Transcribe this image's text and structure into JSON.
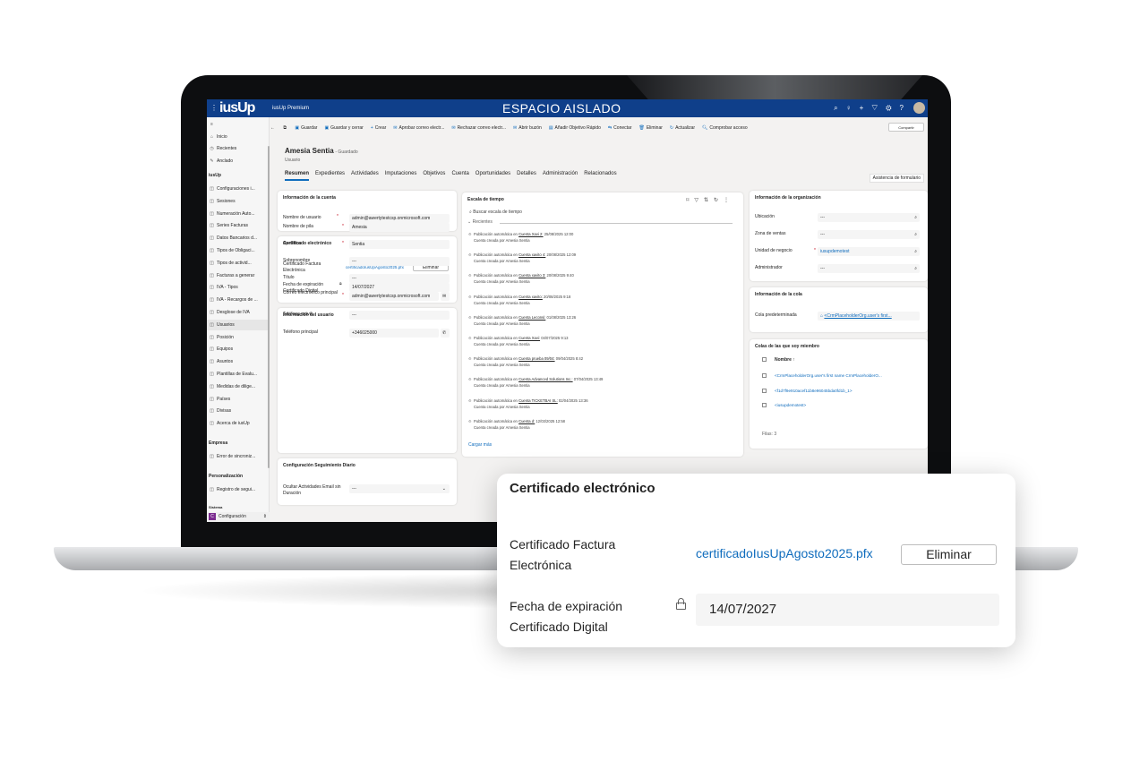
{
  "topbar": {
    "logo": "iusUp",
    "app_title": "iusUp Premium",
    "environment": "ESPACIO AISLADO",
    "icons": [
      "search-icon",
      "lightbulb-icon",
      "plus-icon",
      "filter-icon",
      "gear-icon",
      "help-icon"
    ]
  },
  "sidebar": {
    "items": [
      {
        "label": "Inicio",
        "icon": "home-icon"
      },
      {
        "label": "Recientes",
        "icon": "clock-icon"
      },
      {
        "label": "Anclado",
        "icon": "pin-icon"
      }
    ],
    "section_iusup": "iusUp",
    "iusup_items": [
      "Configuraciones i...",
      "Sesiones",
      "Numeración Auto...",
      "Series Facturas",
      "Datos Bancarios d...",
      "Tipos de Obligaci...",
      "Tipos de activid...",
      "Facturas a generar",
      "IVA - Tipos",
      "IVA - Recargos de ...",
      "Desglose de IVA",
      "Usuarios",
      "Posición",
      "Equipos",
      "Asuntos",
      "Plantillas de Evalu...",
      "Medidas de dilige...",
      "Países",
      "Divisas",
      "Acerca de iusUp"
    ],
    "section_empresa": "Empresa",
    "empresa_items": [
      "Error de sincroniz..."
    ],
    "section_personalizacion": "Personalización",
    "personalizacion_items": [
      "Registro de segui..."
    ],
    "section_sistema": "Sistema",
    "area": {
      "letter": "C",
      "label": "Configuración"
    }
  },
  "commands": [
    "Guardar",
    "Guardar y cerrar",
    "Crear",
    "Aprobar correo electr...",
    "Rechazar correo electr...",
    "Abrir buzón",
    "Añadir Objetivo Rápido",
    "Conectar",
    "Eliminar",
    "Actualizar",
    "Comprobar acceso"
  ],
  "share_label": "Compartir",
  "record": {
    "name": "Amesia Sentia",
    "state": "- Guardado",
    "type": "Usuario"
  },
  "tabs": [
    "Resumen",
    "Expedientes",
    "Actividades",
    "Imputaciones",
    "Objetivos",
    "Cuenta",
    "Oportunidades",
    "Detalles",
    "Administración",
    "Relacionados"
  ],
  "assist_label": "Asistencia de formulario",
  "account": {
    "title": "Información de la cuenta",
    "username_label": "Nombre de usuario",
    "username": "admin@awertytestcsp.onmicrosoft.com"
  },
  "cert": {
    "title": "Certificado electrónico",
    "label": "Certificado Factura Electrónica",
    "label_l1": "Certificado Factura",
    "label_l2": "Electrónica",
    "file": "certificadoIusUpAgosto2025.pfx",
    "delete": "Eliminar",
    "exp_label_l1": "Fecha de expiración",
    "exp_label_l2": "Certificado Digital",
    "exp_date": "14/07/2027"
  },
  "user_info": {
    "title": "Información del usuario",
    "rows": [
      {
        "label": "Nombre de pila",
        "value": "Amesia"
      },
      {
        "label": "Apellidos",
        "value": "Sentia"
      },
      {
        "label": "Sobrenombre",
        "value": "---"
      },
      {
        "label": "Título",
        "value": "---"
      },
      {
        "label": "Correo electrónico principal",
        "value": "admin@awertytestcsp.onmicrosoft.com"
      },
      {
        "label": "Teléfono móvil",
        "value": "---"
      },
      {
        "label": "Teléfono principal",
        "value": "+346025000"
      }
    ]
  },
  "daily": {
    "title": "Configuración Seguimiento Diario",
    "label": "Ocultar Actividades Email sin Duración",
    "value": "---"
  },
  "timeline": {
    "title": "Escala de tiempo",
    "search": "Buscar escala de tiempo",
    "recent": "Recientes",
    "load_more": "Cargar más",
    "items": [
      {
        "prefix": "Publicación automática en",
        "link": "Cuenta Xavi 2:",
        "date": "25/08/2025 12:00",
        "sub": "Cuenta creada por Amesia Sentia"
      },
      {
        "prefix": "Publicación automática en",
        "link": "Cuenta xavito 4:",
        "date": "20/08/2025 12:09",
        "sub": "Cuenta creada por Amesia Sentia"
      },
      {
        "prefix": "Publicación automática en",
        "link": "Cuenta xavito 3:",
        "date": "20/08/2025 9:40",
        "sub": "Cuenta creada por Amesia Sentia"
      },
      {
        "prefix": "Publicación automática en",
        "link": "Cuenta xavito:",
        "date": "20/08/2025 9:18",
        "sub": "Cuenta creada por Amesia Sentia"
      },
      {
        "prefix": "Publicación automática en",
        "link": "Cuenta Leconsi:",
        "date": "01/08/2025 13:26",
        "sub": "Cuenta creada por Amesia Sentia"
      },
      {
        "prefix": "Publicación automática en",
        "link": "Cuenta Xavi:",
        "date": "04/07/2025 9:13",
        "sub": "Cuenta creada por Amesia Sentia"
      },
      {
        "prefix": "Publicación automática en",
        "link": "Cuenta prueba 09/04:",
        "date": "09/04/2025 8:42",
        "sub": "Cuenta creada por Amesia Sentia"
      },
      {
        "prefix": "Publicación automática en",
        "link": "Cuenta Advanced Solutions Inc.:",
        "date": "07/04/2025 13:49",
        "sub": "Cuenta creada por Amesia Sentia"
      },
      {
        "prefix": "Publicación automática en",
        "link": "Cuenta TICKETBAI SL:",
        "date": "02/04/2025 13:36",
        "sub": "Cuenta creada por Amesia Sentia"
      },
      {
        "prefix": "Publicación automática en",
        "link": "Cuenta d:",
        "date": "12/03/2025 12:58",
        "sub": "Cuenta creada por Amesia Sentia"
      }
    ]
  },
  "org": {
    "title": "Información de la organización",
    "rows": [
      {
        "label": "Ubicación",
        "value": "---"
      },
      {
        "label": "Zona de ventas",
        "value": "---"
      },
      {
        "label": "Unidad de negocio",
        "value": "iusupdemotest"
      },
      {
        "label": "Administrador",
        "value": "---"
      }
    ]
  },
  "queue": {
    "title": "Información de la cola",
    "label": "Cola predeterminada",
    "value": "<CrmPlaceholderOrg.user's first..."
  },
  "queues": {
    "title": "Colas de las que soy miembro",
    "col": "Nombre ↑",
    "rows": [
      "<CrmPlaceholderOrg.user's first name CrmPlaceholderO...",
      "<f1d7f9e910acef11b8e96045bda0fd1b_1>",
      "<iusupdemotest>"
    ],
    "count": "Filas: 3"
  },
  "colors": {
    "brand": "#0f3f8a",
    "link": "#0f6cbd",
    "required": "#c50f1f"
  }
}
